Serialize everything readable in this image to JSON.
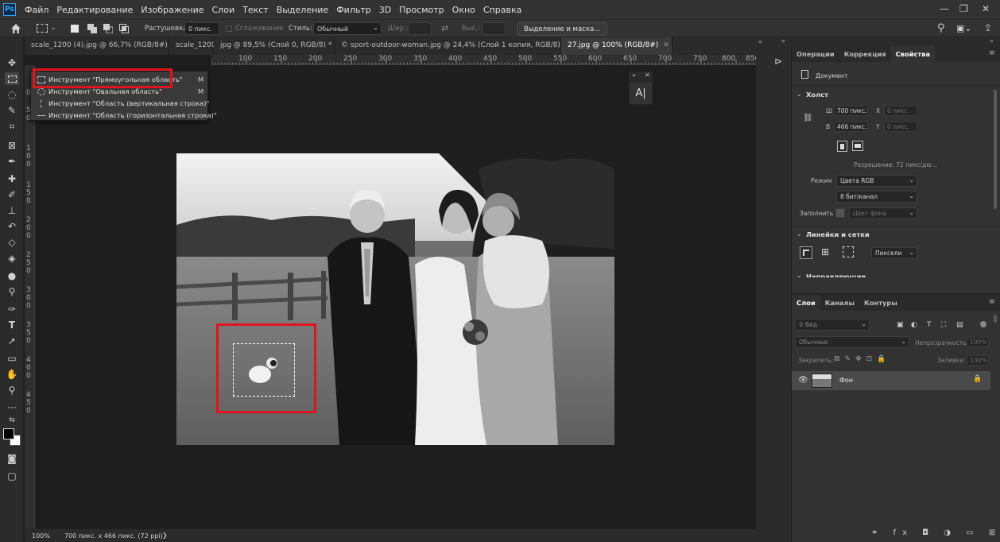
{
  "app": {
    "logo": "Ps"
  },
  "menu": [
    "Файл",
    "Редактирование",
    "Изображение",
    "Слои",
    "Текст",
    "Выделение",
    "Фильтр",
    "3D",
    "Просмотр",
    "Окно",
    "Справка"
  ],
  "window_controls": {
    "minimize": "—",
    "restore": "❐",
    "close": "✕"
  },
  "options": {
    "feather_label": "Растушевка:",
    "feather_value": "0 пикс.",
    "antialias_label": "Сглаживание",
    "style_label": "Стиль:",
    "style_value": "Обычный",
    "width_label": "Шир.:",
    "height_label": "Выс.:",
    "select_mask_button": "Выделение и маска..."
  },
  "doc_tabs": [
    {
      "label": "scale_1200 (4).jpg @ 66,7% (RGB/8#) *",
      "active": false
    },
    {
      "label": "scale_1200",
      "active": false
    },
    {
      "label": "jpg @ 89,5% (Слой 0, RGB/8) *",
      "active": false
    },
    {
      "label": "© sport-outdoor-woman.jpg @ 24,4% (Слой 1 копия, RGB/8) *",
      "active": false
    },
    {
      "label": "27.jpg @ 100% (RGB/8#)",
      "active": true
    }
  ],
  "ruler_top": [
    "100",
    "150",
    "200",
    "250",
    "300",
    "350",
    "400",
    "450",
    "500",
    "550",
    "600",
    "650",
    "700",
    "750",
    "800",
    "850"
  ],
  "ruler_left": [
    "0",
    "5",
    "0",
    "1",
    "0",
    "0",
    "1",
    "5",
    "0",
    "2",
    "0",
    "0",
    "2",
    "5",
    "0",
    "3",
    "0",
    "0",
    "3",
    "5",
    "0",
    "4",
    "0",
    "0",
    "4",
    "5",
    "0"
  ],
  "flyout": [
    {
      "label": "Инструмент \"Прямоугольная область\"",
      "key": "M"
    },
    {
      "label": "Инструмент \"Овальная область\"",
      "key": "M"
    },
    {
      "label": "Инструмент \"Область (вертикальная строка)\"",
      "key": ""
    },
    {
      "label": "Инструмент \"Область (горизонтальная строка)\"",
      "key": ""
    }
  ],
  "status": {
    "zoom": "100%",
    "doc_info": "700 пикс. x 466 пикс. (72 ppi)",
    "arrow": "❯"
  },
  "properties": {
    "tabs": [
      "Операции",
      "Коррекция",
      "Свойства"
    ],
    "doc_label": "Документ",
    "canvas_title": "Холст",
    "w_label": "Ш",
    "w_value": "700 пикс.",
    "x_label": "X",
    "x_value": "0 пикс.",
    "h_label": "В",
    "h_value": "466 пикс.",
    "y_label": "Y",
    "y_value": "0 пикс.",
    "resolution": "Разрешение: 72 пикс/дю...",
    "mode_label": "Режим",
    "mode_value": "Цвета RGB",
    "depth_value": "8 бит/канал",
    "fill_label": "Заполнить",
    "fill_value": "Цвет фона",
    "rulers_title": "Линейки и сетки",
    "units_value": "Пиксели",
    "guides_title": "Направляющие"
  },
  "layers": {
    "tabs": [
      "Слои",
      "Каналы",
      "Контуры"
    ],
    "search_placeholder": "Вид",
    "blend_mode": "Обычные",
    "opacity_label": "Непрозрачность:",
    "opacity_value": "100%",
    "lock_label": "Закрепить:",
    "fill_label": "Заливка:",
    "fill_value": "100%",
    "layer_name": "Фон",
    "bottom_icons": "⚭ fx ◘ ◑ ▭ ⊞ 🗑"
  },
  "colors": {
    "highlight": "#e0141e",
    "panel": "#323232",
    "canvas": "#1e1e1e"
  }
}
